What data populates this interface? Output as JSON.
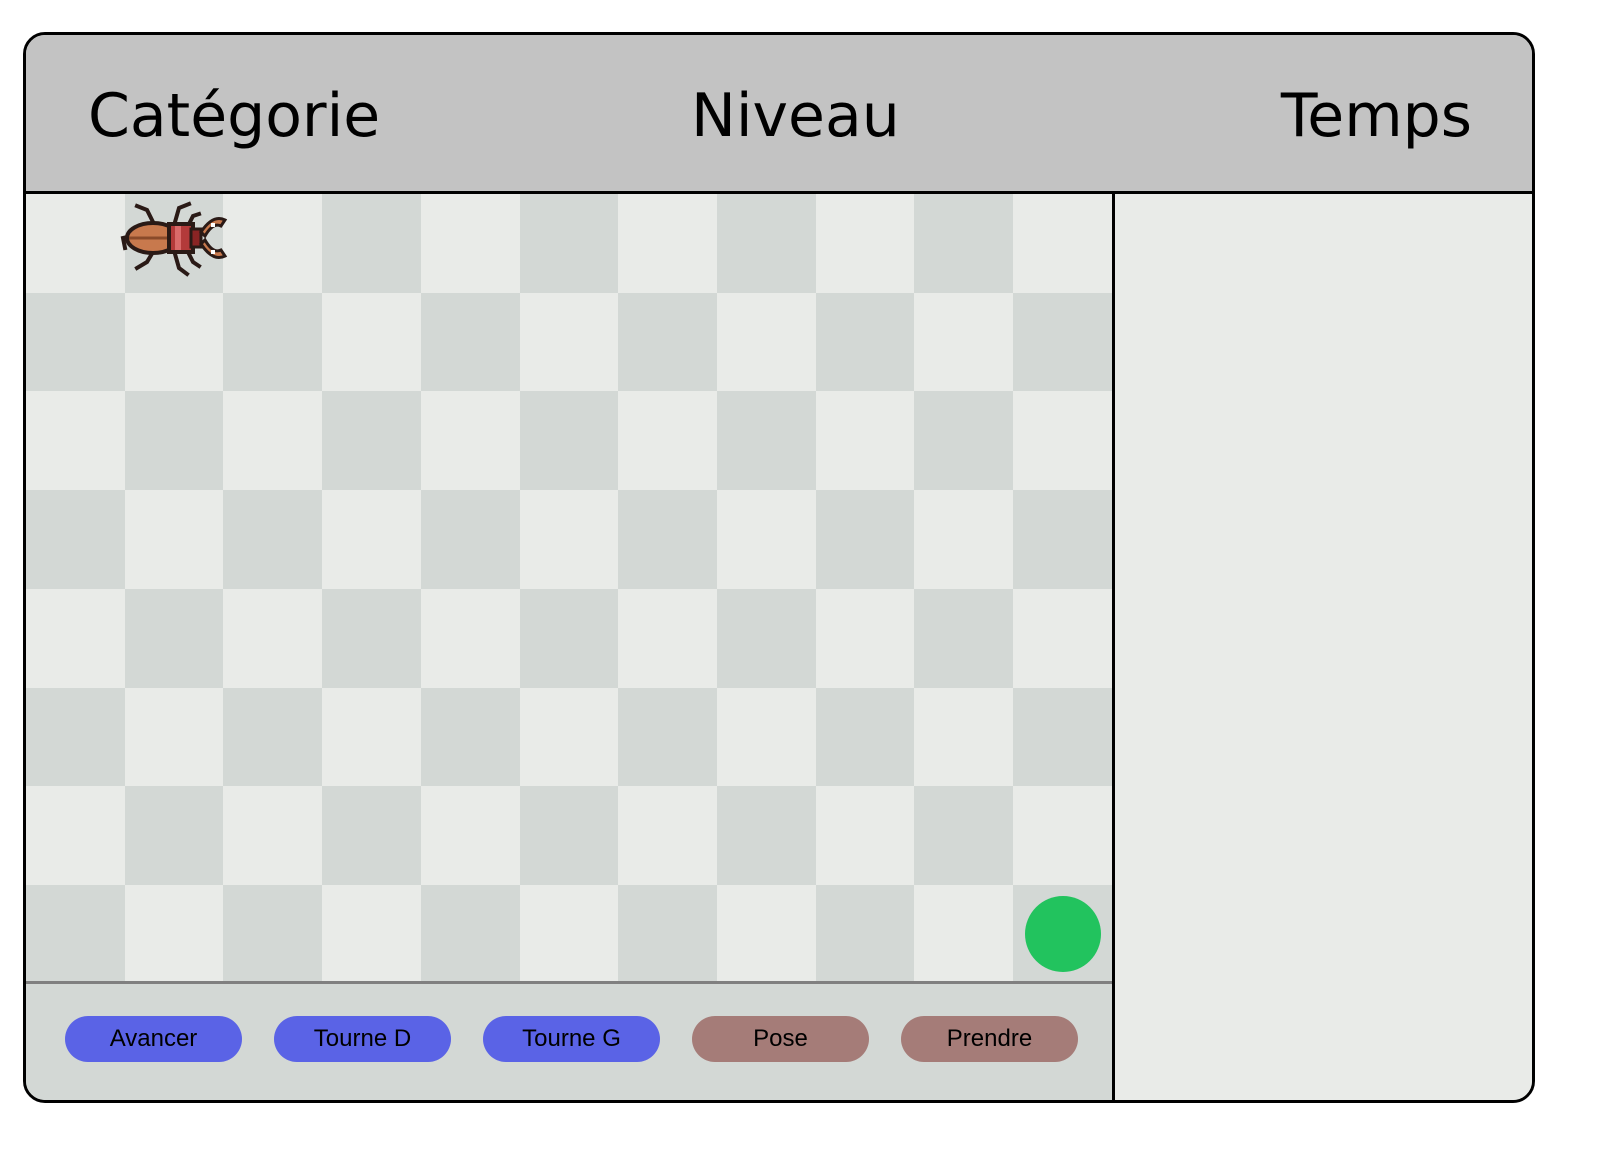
{
  "header": {
    "category_label": "Catégorie",
    "level_label": "Niveau",
    "time_label": "Temps"
  },
  "board": {
    "columns": 11,
    "rows": 8,
    "light_color": "#e9ebe8",
    "dark_color": "#d3d8d5",
    "player": {
      "icon": "stag-beetle-icon",
      "column": 1,
      "row": 0,
      "facing": "right"
    },
    "goal": {
      "icon": "green-circle-goal",
      "column": 10,
      "row": 7,
      "color": "#22c35e"
    }
  },
  "controls": {
    "buttons": [
      {
        "label": "Avancer",
        "color": "#5a63e6"
      },
      {
        "label": "Tourne D",
        "color": "#5a63e6"
      },
      {
        "label": "Tourne G",
        "color": "#5a63e6"
      },
      {
        "label": "Pose",
        "color": "#a57c78"
      },
      {
        "label": "Prendre",
        "color": "#a57c78"
      }
    ]
  }
}
